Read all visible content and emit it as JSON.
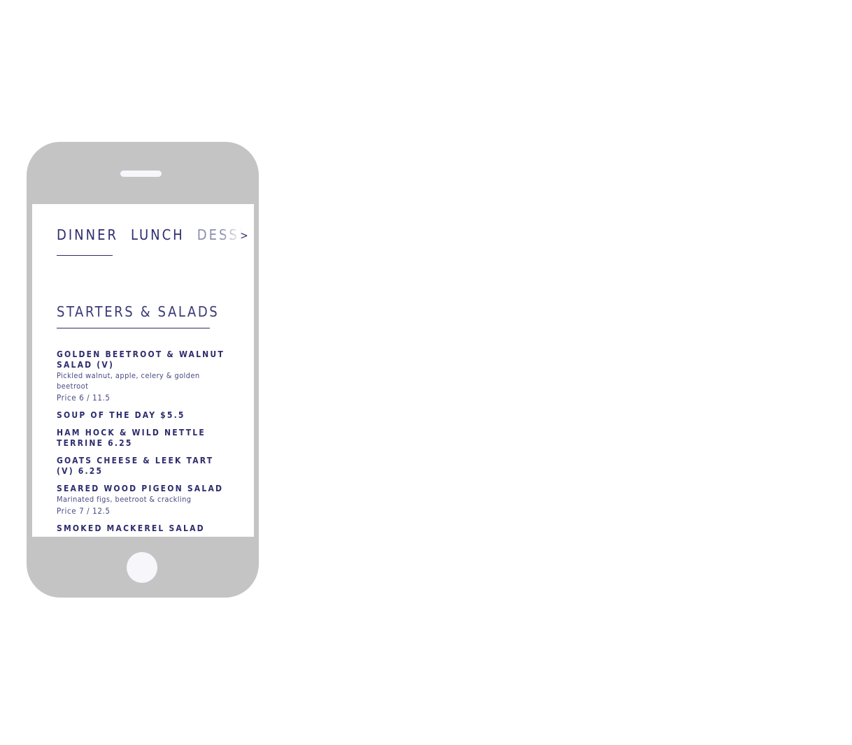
{
  "tabs": [
    {
      "label": "DINNER"
    },
    {
      "label": "LUNCH"
    },
    {
      "label": "DESSER"
    }
  ],
  "tab_next": ">",
  "section": {
    "title": "STARTERS & SALADS"
  },
  "items": [
    {
      "name": "GOLDEN BEETROOT & WALNUT SALAD (V)",
      "desc": "Pickled walnut, apple, celery & golden beetroot",
      "price": "Price 6 / 11.5"
    },
    {
      "name": "SOUP OF THE DAY $5.5"
    },
    {
      "name": "HAM HOCK & WILD NETTLE TERRINE 6.25"
    },
    {
      "name": "GOATS CHEESE & LEEK TART (V) 6.25"
    },
    {
      "name": "SEARED WOOD PIGEON SALAD",
      "desc": "Marinated figs, beetroot & crackling",
      "price": "Price 7 / 12.5"
    },
    {
      "name": "SMOKED MACKEREL SALAD"
    }
  ]
}
